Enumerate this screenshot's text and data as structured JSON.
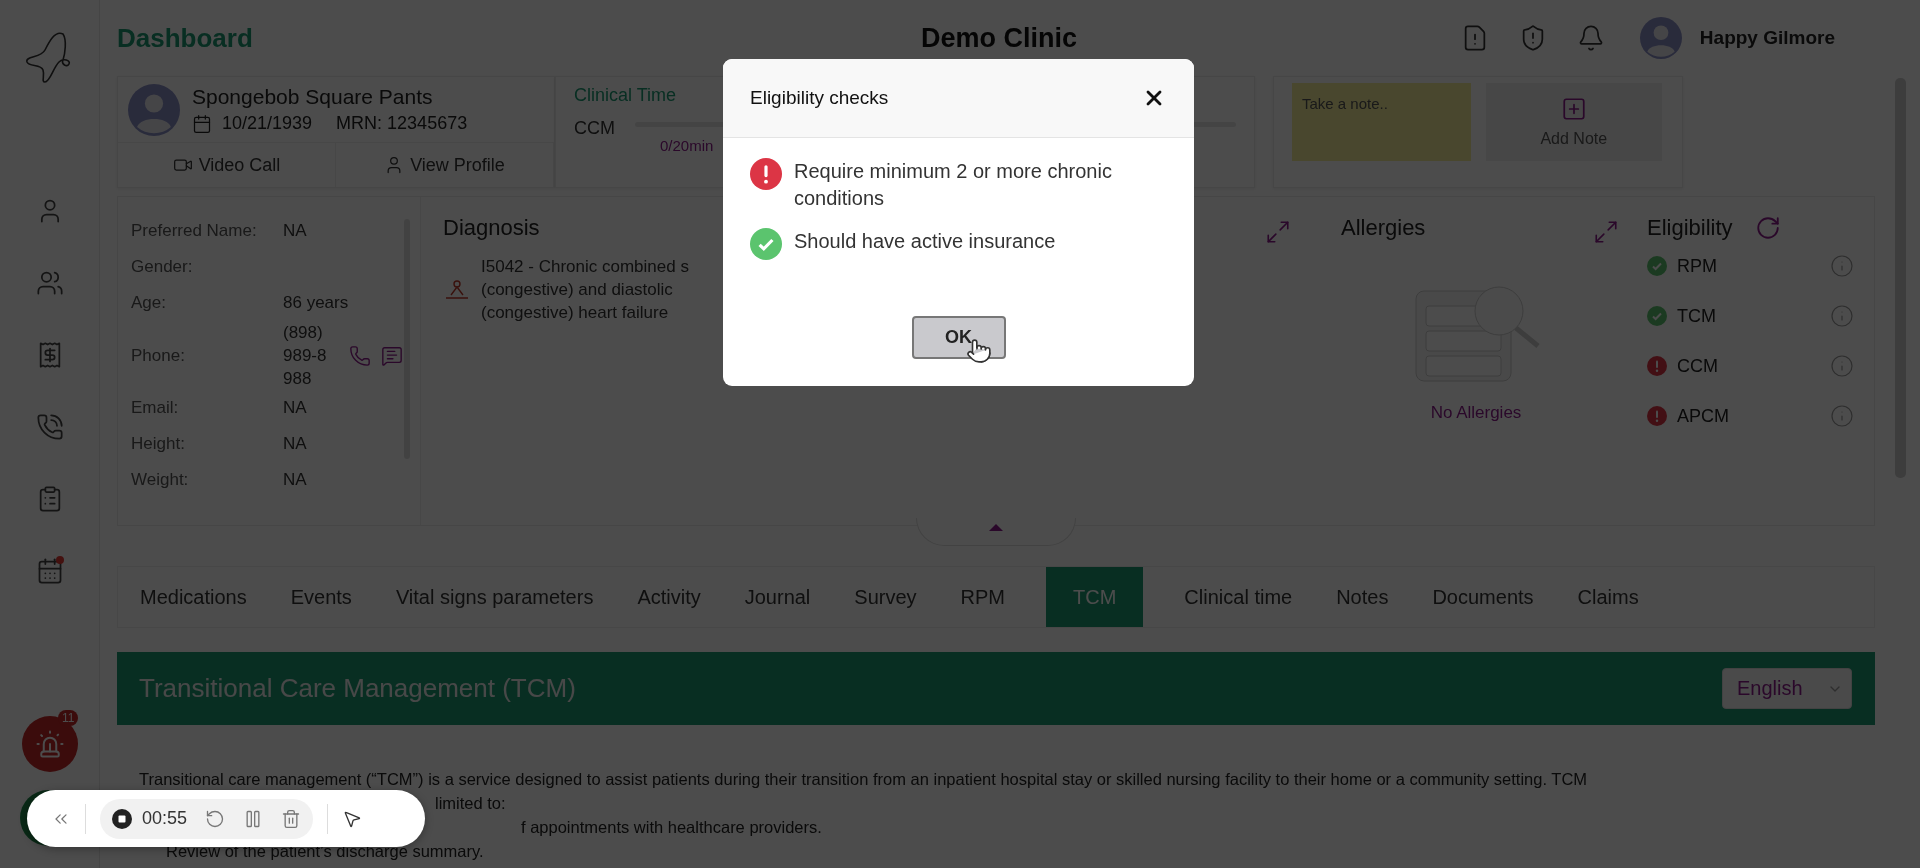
{
  "header": {
    "title": "Dashboard",
    "clinic": "Demo Clinic",
    "user": "Happy Gilmore"
  },
  "patient": {
    "name": "Spongebob Square Pants",
    "dob": "10/21/1939",
    "mrn": "MRN: 12345673",
    "actions": [
      {
        "kind": "video",
        "label": "Video Call"
      },
      {
        "kind": "profile",
        "label": "View Profile"
      }
    ]
  },
  "clinical_time": {
    "title": "Clinical Time",
    "rows": [
      {
        "label": "CCM",
        "level": 0,
        "reading": "0/20min"
      }
    ]
  },
  "notes": {
    "placeholder": "Take a note..",
    "add_label": "Add Note"
  },
  "details": [
    {
      "label": "Preferred Name:",
      "value": "NA"
    },
    {
      "label": "Gender:"
    },
    {
      "label": "Age:",
      "value": "86 years"
    },
    {
      "label": "Phone:",
      "value": "(898) 989-8988",
      "kind": "phone"
    },
    {
      "label": "Email:",
      "value": "NA"
    },
    {
      "label": "Height:",
      "value": "NA"
    },
    {
      "label": "Weight:",
      "value": "NA"
    }
  ],
  "diagnosis": {
    "title": "Diagnosis",
    "lines": [
      "I5042 - Chronic combined s",
      "(congestive) and diastolic",
      "(congestive) heart failure"
    ]
  },
  "allergies": {
    "title": "Allergies",
    "empty": "No Allergies"
  },
  "eligibility": {
    "title": "Eligibility",
    "items": [
      {
        "label": "RPM",
        "kind": "eligible"
      },
      {
        "label": "TCM",
        "kind": "eligible"
      },
      {
        "label": "CCM",
        "kind": "ineligible"
      },
      {
        "label": "APCM",
        "kind": "ineligible"
      }
    ]
  },
  "tabs": [
    {
      "label": "Medications",
      "selected": false
    },
    {
      "label": "Events",
      "selected": false
    },
    {
      "label": "Vital signs parameters",
      "selected": false
    },
    {
      "label": "Activity",
      "selected": false
    },
    {
      "label": "Journal",
      "selected": false
    },
    {
      "label": "Survey",
      "selected": false
    },
    {
      "label": "RPM",
      "selected": false
    },
    {
      "label": "TCM",
      "selected": true
    },
    {
      "label": "Clinical time",
      "selected": false
    },
    {
      "label": "Notes",
      "selected": false
    },
    {
      "label": "Documents",
      "selected": false
    },
    {
      "label": "Claims",
      "selected": false
    }
  ],
  "section": {
    "title": "Transitional Care Management (TCM)",
    "language": "English",
    "intro": "Transitional care management (“TCM”) is a service designed to assist patients during their transition from an inpatient hospital stay or skilled nursing facility to their home or a community setting. TCM",
    "fragments": [
      "limited to:",
      "f appointments with healthcare providers.",
      "Review of the patient’s discharge summary."
    ]
  },
  "alarm": {
    "count": "11"
  },
  "recorder": {
    "time": "00:55"
  },
  "modal": {
    "title": "Eligibility checks",
    "items": [
      {
        "kind": "failed",
        "text": "Require minimum 2 or more chronic conditions"
      },
      {
        "kind": "passed",
        "text": "Should have active insurance"
      }
    ],
    "button": "OK"
  }
}
